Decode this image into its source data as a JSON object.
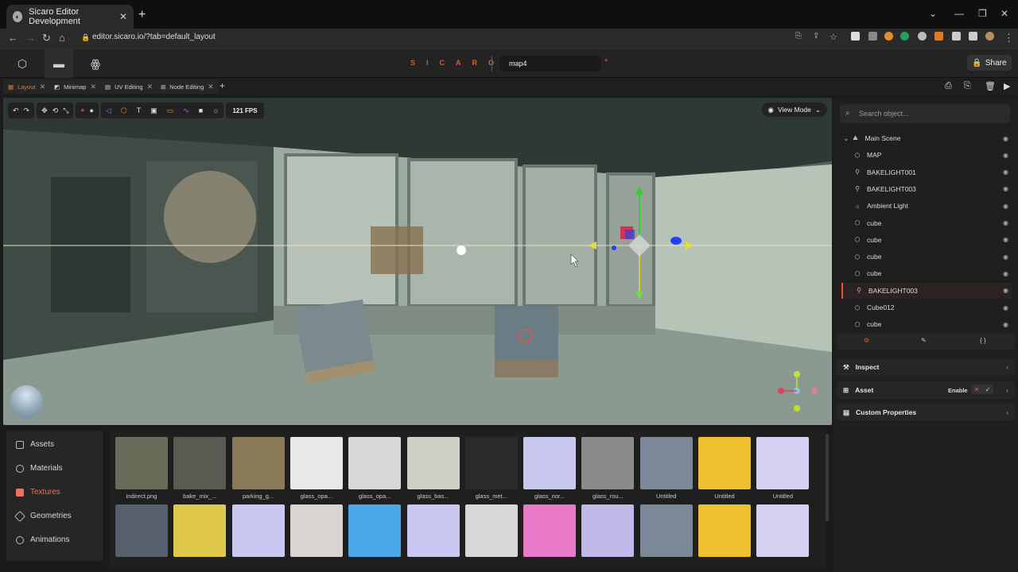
{
  "browser": {
    "tab_title": "Sicaro Editor Development",
    "url": "editor.sicaro.io/?tab=default_layout"
  },
  "app": {
    "brand": "SICARO",
    "map_name": "map4",
    "unsaved_marker": "*",
    "share_label": "Share"
  },
  "editor_tabs": [
    {
      "label": "Layout"
    },
    {
      "label": "Minimap"
    },
    {
      "label": "UV Editing"
    },
    {
      "label": "Node Editing"
    }
  ],
  "viewport": {
    "fps_label": "121  FPS",
    "view_mode_label": "View Mode"
  },
  "asset_nav": [
    {
      "label": "Assets"
    },
    {
      "label": "Materials"
    },
    {
      "label": "Textures"
    },
    {
      "label": "Geometries"
    },
    {
      "label": "Animations"
    }
  ],
  "textures_row1": [
    {
      "label": "indirect.png",
      "color": "#6b6b5a"
    },
    {
      "label": "bake_mix_...",
      "color": "#5a5a52"
    },
    {
      "label": "parking_g...",
      "color": "#8a7a5a"
    },
    {
      "label": "glass_opa...",
      "color": "#e8e8e8"
    },
    {
      "label": "glass_opa...",
      "color": "#d8d8d8"
    },
    {
      "label": "glass_bas...",
      "color": "#d0cfc8"
    },
    {
      "label": "glass_met...",
      "color": "#2a2a2a"
    },
    {
      "label": "glass_nor...",
      "color": "#c8c8ee"
    },
    {
      "label": "glass_rou...",
      "color": "#8a8a8a"
    },
    {
      "label": "Untitled",
      "color": "#7a8898"
    },
    {
      "label": "Untitled",
      "color": "#f0c030"
    },
    {
      "label": "Untitled",
      "color": "#d6d0f2"
    }
  ],
  "textures_row2": [
    {
      "color": "#56606c"
    },
    {
      "color": "#e0c84a"
    },
    {
      "color": "#c8c8f0"
    },
    {
      "color": "#d8d4d0"
    },
    {
      "color": "#4aa8e8"
    },
    {
      "color": "#c8c8f0"
    },
    {
      "color": "#d8d8d8"
    },
    {
      "color": "#e878c8"
    },
    {
      "color": "#c0b8e8"
    },
    {
      "color": "#7a8898"
    },
    {
      "color": "#f0c030"
    },
    {
      "color": "#d6d0f2"
    }
  ],
  "outliner": {
    "search_placeholder": "Search object...",
    "items": [
      {
        "label": "Main Scene",
        "icon": "scene-icon"
      },
      {
        "label": "MAP",
        "icon": "mesh-icon"
      },
      {
        "label": "BAKELIGHT001",
        "icon": "light-icon"
      },
      {
        "label": "BAKELIGHT003",
        "icon": "light-icon"
      },
      {
        "label": "Ambient Light",
        "icon": "sun-icon"
      },
      {
        "label": "cube",
        "icon": "mesh-icon"
      },
      {
        "label": "cube",
        "icon": "mesh-icon"
      },
      {
        "label": "cube",
        "icon": "mesh-icon"
      },
      {
        "label": "cube",
        "icon": "mesh-icon"
      },
      {
        "label": "BAKELIGHT003",
        "icon": "light-icon",
        "selected": true
      },
      {
        "label": "Cube012",
        "icon": "mesh-icon"
      },
      {
        "label": "cube",
        "icon": "mesh-icon"
      }
    ]
  },
  "properties": {
    "inspect_label": "Inspect",
    "asset_label": "Asset",
    "enable_label": "Enable",
    "custom_label": "Custom Properties"
  },
  "colors": {
    "accent": "#e05a2b"
  }
}
